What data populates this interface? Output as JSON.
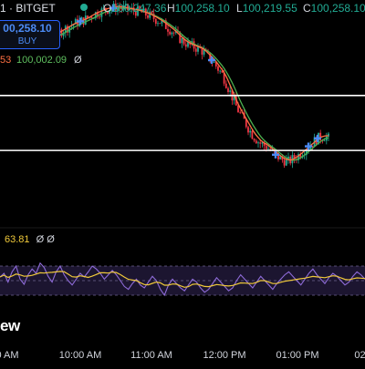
{
  "symbol": "1 · BITGET",
  "ohlc": {
    "open_label": "O",
    "open": "100,247.36",
    "high_label": "H",
    "high": "100,258.10",
    "low_label": "L",
    "low": "100,219.55",
    "close_label": "C",
    "close": "100,258.10"
  },
  "order": {
    "price": "00,258.10",
    "side": "BUY"
  },
  "ma_legend": {
    "a": "53",
    "b": "100,002.09",
    "c": "Ø"
  },
  "rsi_legend": {
    "value": "63.81",
    "nulls": "Ø Ø"
  },
  "logo_text": "ew",
  "time_axis": [
    "0 AM",
    "10:00 AM",
    "11:00 AM",
    "12:00 PM",
    "01:00 PM",
    "02:"
  ],
  "colors": {
    "up": "#22ab94",
    "down": "#f23645",
    "ma_fast": "#ff7043",
    "ma_slow": "#4caf50",
    "rsi_line": "#8e6bd8",
    "rsi_ma": "#f0c93a",
    "rsi_band": "#1c1530",
    "marker": "#4c8bf5",
    "hline": "#ffffff"
  },
  "chart_data": {
    "type": "candlestick",
    "price_path": [
      [
        0.0,
        0.87
      ],
      [
        0.3,
        0.86
      ],
      [
        0.6,
        0.84
      ],
      [
        0.9,
        0.85
      ],
      [
        1.2,
        0.86
      ],
      [
        1.5,
        0.89
      ],
      [
        1.8,
        0.92
      ],
      [
        2.1,
        0.94
      ],
      [
        2.4,
        0.97
      ],
      [
        2.7,
        0.99
      ],
      [
        3.0,
        1.0
      ],
      [
        3.3,
        0.99
      ],
      [
        3.6,
        0.98
      ],
      [
        3.9,
        0.96
      ],
      [
        4.2,
        0.93
      ],
      [
        4.5,
        0.89
      ],
      [
        4.8,
        0.84
      ],
      [
        5.0,
        0.82
      ],
      [
        5.3,
        0.8
      ],
      [
        5.6,
        0.75
      ],
      [
        5.9,
        0.68
      ],
      [
        6.1,
        0.6
      ],
      [
        6.3,
        0.52
      ],
      [
        6.5,
        0.46
      ],
      [
        6.7,
        0.4
      ],
      [
        6.9,
        0.36
      ],
      [
        7.1,
        0.34
      ],
      [
        7.3,
        0.31
      ],
      [
        7.5,
        0.28
      ],
      [
        7.7,
        0.27
      ],
      [
        7.9,
        0.29
      ],
      [
        8.1,
        0.32
      ],
      [
        8.3,
        0.35
      ],
      [
        8.5,
        0.38
      ],
      [
        8.7,
        0.39
      ],
      [
        8.8,
        0.38
      ]
    ],
    "price_markers": [
      0.6,
      2.0,
      2.9,
      5.6,
      7.35,
      8.25,
      8.5
    ],
    "levels": [
      0.6,
      0.34
    ],
    "rsi": [
      55,
      60,
      48,
      62,
      70,
      52,
      45,
      58,
      66,
      60,
      74,
      68,
      56,
      48,
      62,
      70,
      58,
      50,
      44,
      52,
      60,
      55,
      62,
      70,
      66,
      60,
      52,
      58,
      64,
      58,
      50,
      42,
      38,
      46,
      52,
      44,
      40,
      48,
      56,
      50,
      38,
      30,
      44,
      52,
      46,
      40,
      36,
      44,
      52,
      48,
      40,
      34,
      38,
      46,
      54,
      48,
      42,
      36,
      40,
      50,
      58,
      52,
      46,
      40,
      48,
      56,
      50,
      44,
      38,
      46,
      52,
      58,
      62,
      56,
      50,
      44,
      52,
      60,
      66,
      58,
      52,
      46,
      54,
      60,
      56,
      50,
      44,
      48,
      56,
      62,
      58,
      52
    ],
    "rsi_levels": [
      70,
      50,
      30
    ]
  }
}
